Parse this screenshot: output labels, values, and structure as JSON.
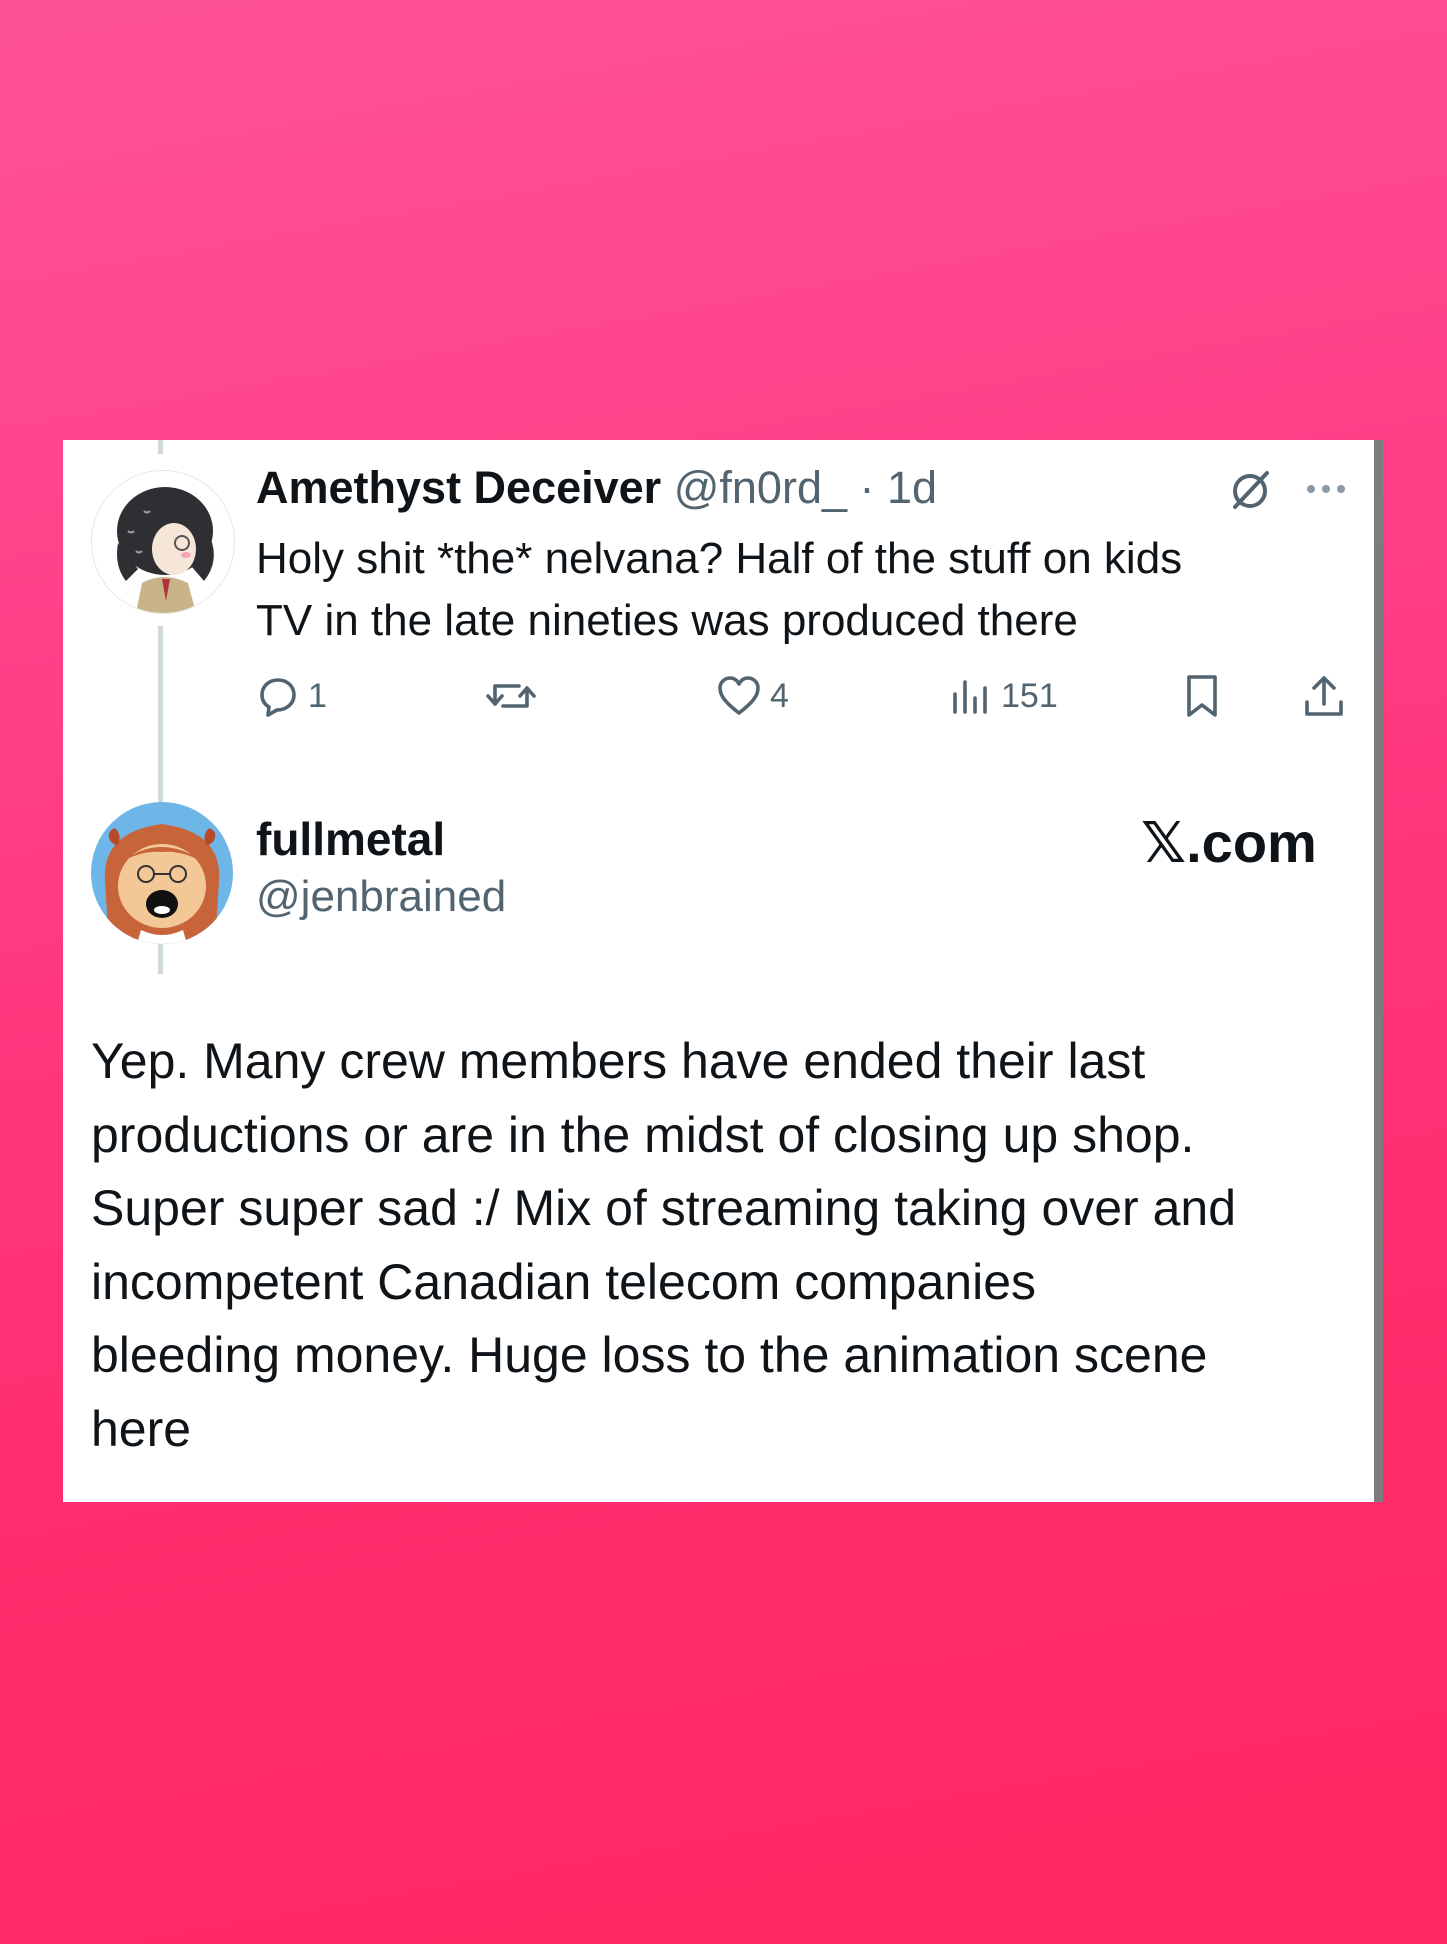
{
  "reply_tweet": {
    "display_name": "Amethyst Deceiver",
    "handle": "@fn0rd_",
    "separator": "·",
    "time": "1d",
    "text_line1": "Holy shit *the* nelvana? Half of the stuff on kids",
    "text_line2": "TV in the late nineties was produced there",
    "status_icon": "grok-slash-icon",
    "more_icon": "more-dots-icon",
    "actions": {
      "reply": {
        "icon": "reply-bubble-icon",
        "count": "1"
      },
      "repost": {
        "icon": "repost-icon",
        "count": ""
      },
      "like": {
        "icon": "heart-icon",
        "count": "4"
      },
      "views": {
        "icon": "views-chart-icon",
        "count": "151"
      },
      "bookmark": {
        "icon": "bookmark-icon"
      },
      "share": {
        "icon": "share-icon"
      }
    }
  },
  "main_tweet": {
    "display_name": "fullmetal",
    "handle": "@jenbrained",
    "site_label": "𝕏.com",
    "text_lines": [
      "Yep. Many crew members have ended their last",
      "productions or are in the midst of closing up shop.",
      "Super super sad :/ Mix of streaming taking over and",
      "incompetent Canadian telecom companies",
      "bleeding money. Huge loss to the animation scene",
      "here"
    ]
  },
  "colors": {
    "background_top": "#ff5296",
    "background_bottom": "#ff2a62",
    "card": "#ffffff",
    "text_primary": "#0f1419",
    "text_secondary": "#536471"
  }
}
